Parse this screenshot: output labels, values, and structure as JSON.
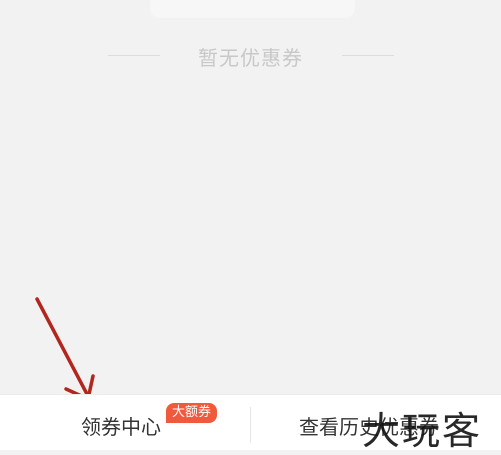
{
  "empty_state": {
    "message": "暂无优惠券"
  },
  "bottom_bar": {
    "coupon_center_label": "领券中心",
    "coupon_center_badge": "大额券",
    "history_label": "查看历史优惠券"
  },
  "watermark": {
    "text": "大玩客"
  },
  "colors": {
    "background": "#f2f2f2",
    "badge": "#f05a3c",
    "arrow": "#b3261e"
  }
}
